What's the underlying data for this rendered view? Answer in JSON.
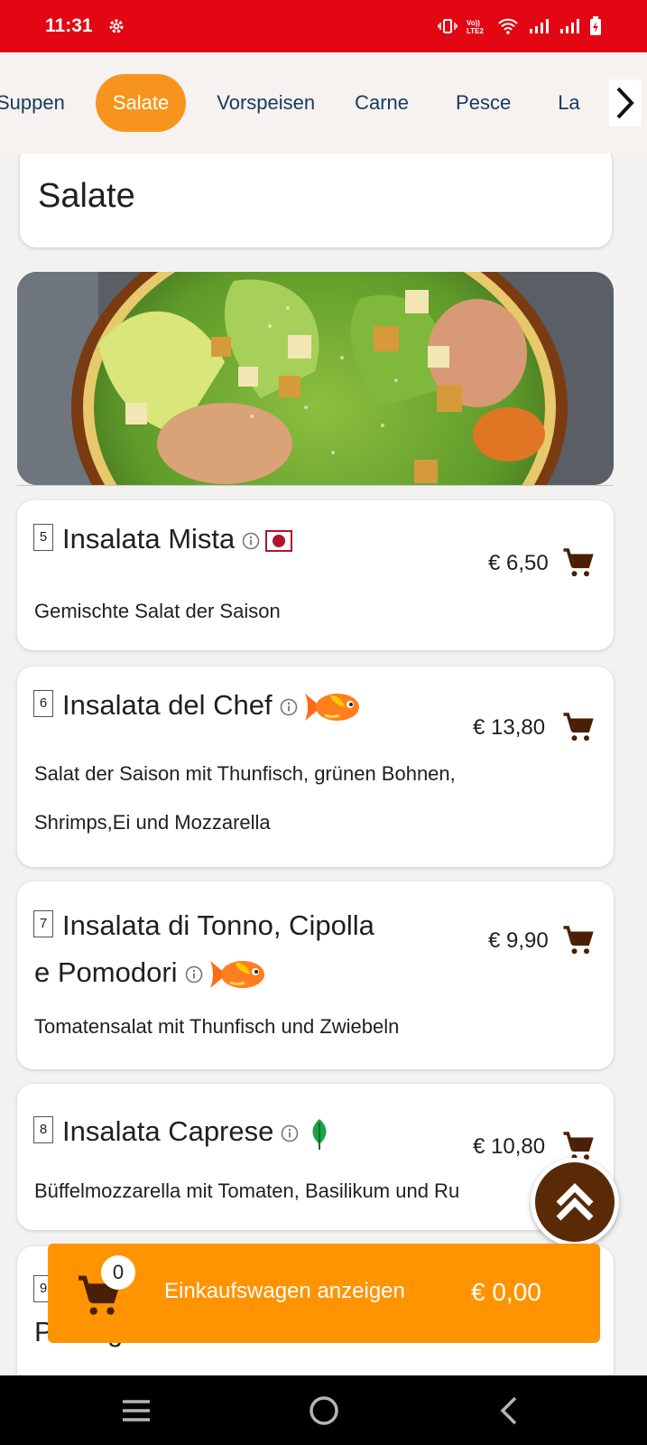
{
  "status_bar": {
    "time": "11:31",
    "icons": [
      "gear-icon",
      "vibrate-icon",
      "volte-icon",
      "wifi-icon",
      "signal-icon",
      "signal-icon",
      "battery-charging-icon"
    ]
  },
  "categories": {
    "items": [
      "Suppen",
      "Salate",
      "Vorspeisen",
      "Carne",
      "Pesce",
      "La"
    ],
    "active": "Salate",
    "next_icon": "chevron-right-icon"
  },
  "section": {
    "title": "Salate"
  },
  "menu_items": [
    {
      "number": "5",
      "name": "Insalata Mista",
      "tag": "halal-badge",
      "price": "€ 6,50",
      "description": "Gemischte Salat der Saison"
    },
    {
      "number": "6",
      "name": "Insalata del Chef",
      "tag": "fish-icon",
      "price": "€ 13,80",
      "description_lines": [
        "Salat der Saison mit Thunfisch, grünen Bohnen,",
        "Shrimps,Ei und Mozzarella"
      ]
    },
    {
      "number": "7",
      "name_lines": [
        "Insalata di Tonno, Cipolla",
        "e Pomodori"
      ],
      "tag": "fish-icon",
      "price": "€ 9,90",
      "description": "Tomatensalat mit Thunfisch und Zwiebeln"
    },
    {
      "number": "8",
      "name": "Insalata Caprese",
      "tag": "leaf-icon",
      "price": "€ 10,80",
      "description": "Büffelmozzarella mit Tomaten, Basilikum und Ru"
    },
    {
      "number": "9",
      "name": "Parmigiano"
    }
  ],
  "cart": {
    "count": "0",
    "label": "Einkaufswagen anzeigen",
    "total": "€ 0,00"
  },
  "colors": {
    "status_bar": "#e30613",
    "accent": "#f7941d",
    "cart_bar": "#ff9300",
    "dark_brown": "#5a2a06"
  }
}
